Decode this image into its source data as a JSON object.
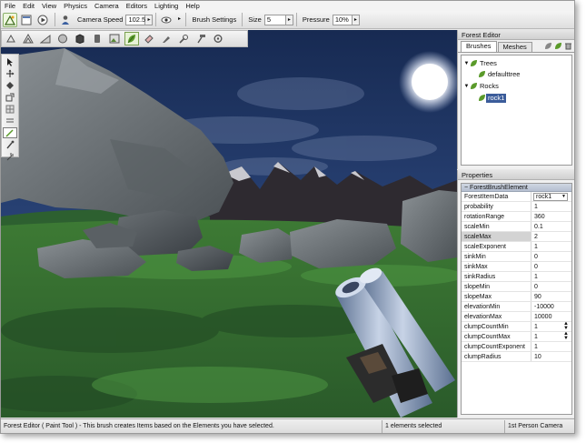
{
  "menu": [
    "File",
    "Edit",
    "View",
    "Physics",
    "Camera",
    "Editors",
    "Lighting",
    "Help"
  ],
  "toolbar": {
    "camera_speed_label": "Camera Speed",
    "camera_speed_value": "102.5",
    "brush_settings_label": "Brush Settings",
    "size_label": "Size",
    "size_value": "5",
    "pressure_label": "Pressure",
    "pressure_value": "10%"
  },
  "forest_editor": {
    "title": "Forest Editor",
    "tabs": [
      "Brushes",
      "Meshes"
    ],
    "tree": [
      {
        "label": "Trees",
        "level": 0,
        "expanded": true
      },
      {
        "label": "defaulttree",
        "level": 1
      },
      {
        "label": "Rocks",
        "level": 0,
        "expanded": true
      },
      {
        "label": "rock1",
        "level": 1,
        "selected": true
      }
    ]
  },
  "properties": {
    "title": "Properties",
    "group": "ForestBrushElement",
    "rows": [
      {
        "name": "ForestItemData",
        "value": "rock1",
        "dropdown": true
      },
      {
        "name": "probability",
        "value": "1"
      },
      {
        "name": "rotationRange",
        "value": "360"
      },
      {
        "name": "scaleMin",
        "value": "0.1"
      },
      {
        "name": "scaleMax",
        "value": "2",
        "highlight": true
      },
      {
        "name": "scaleExponent",
        "value": "1"
      },
      {
        "name": "sinkMin",
        "value": "0"
      },
      {
        "name": "sinkMax",
        "value": "0"
      },
      {
        "name": "sinkRadius",
        "value": "1"
      },
      {
        "name": "slopeMin",
        "value": "0"
      },
      {
        "name": "slopeMax",
        "value": "90"
      },
      {
        "name": "elevationMin",
        "value": "-10000"
      },
      {
        "name": "elevationMax",
        "value": "10000"
      },
      {
        "name": "clumpCountMin",
        "value": "1",
        "spinner": true
      },
      {
        "name": "clumpCountMax",
        "value": "1",
        "spinner": true
      },
      {
        "name": "clumpCountExponent",
        "value": "1"
      },
      {
        "name": "clumpRadius",
        "value": "10"
      }
    ]
  },
  "status": {
    "message": "Forest Editor ( Paint Tool ) - This brush creates Items based on the Elements you have selected.",
    "selection": "1 elements selected",
    "camera": "1st Person Camera"
  },
  "colors": {
    "accent_green": "#5a9a2a",
    "selection_blue": "#3b5c9a"
  }
}
